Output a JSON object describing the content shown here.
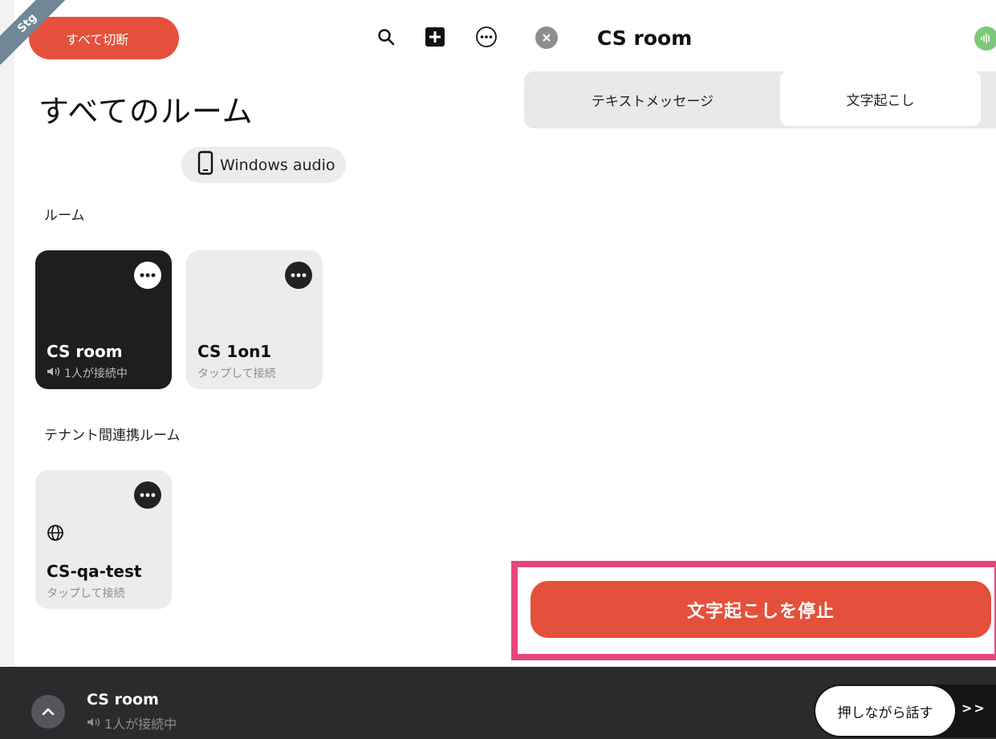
{
  "header": {
    "env_badge": "Stg",
    "disconnect_all_label": "すべて切断"
  },
  "page": {
    "title": "すべてのルーム",
    "audio_device": "Windows audio"
  },
  "sections": {
    "rooms_label": "ルーム",
    "tenant_rooms_label": "テナント間連携ルーム"
  },
  "rooms": [
    {
      "name": "CS room",
      "status": "1人が接続中",
      "active": true
    },
    {
      "name": "CS 1on1",
      "status": "タップして接続",
      "active": false
    }
  ],
  "tenant_rooms": [
    {
      "name": "CS-qa-test",
      "status": "タップして接続"
    }
  ],
  "panel": {
    "room_title": "CS room",
    "tabs": [
      {
        "label": "テキストメッセージ",
        "selected": false
      },
      {
        "label": "文字起こし",
        "selected": true
      }
    ],
    "stop_transcription_label": "文字起こしを停止",
    "highlight_color": "#e6457d",
    "accent_color": "#e4503b"
  },
  "bottom_bar": {
    "room_name": "CS room",
    "status": "1人が接続中",
    "push_to_talk_label": "押しながら話す",
    "arrows": ">>"
  }
}
